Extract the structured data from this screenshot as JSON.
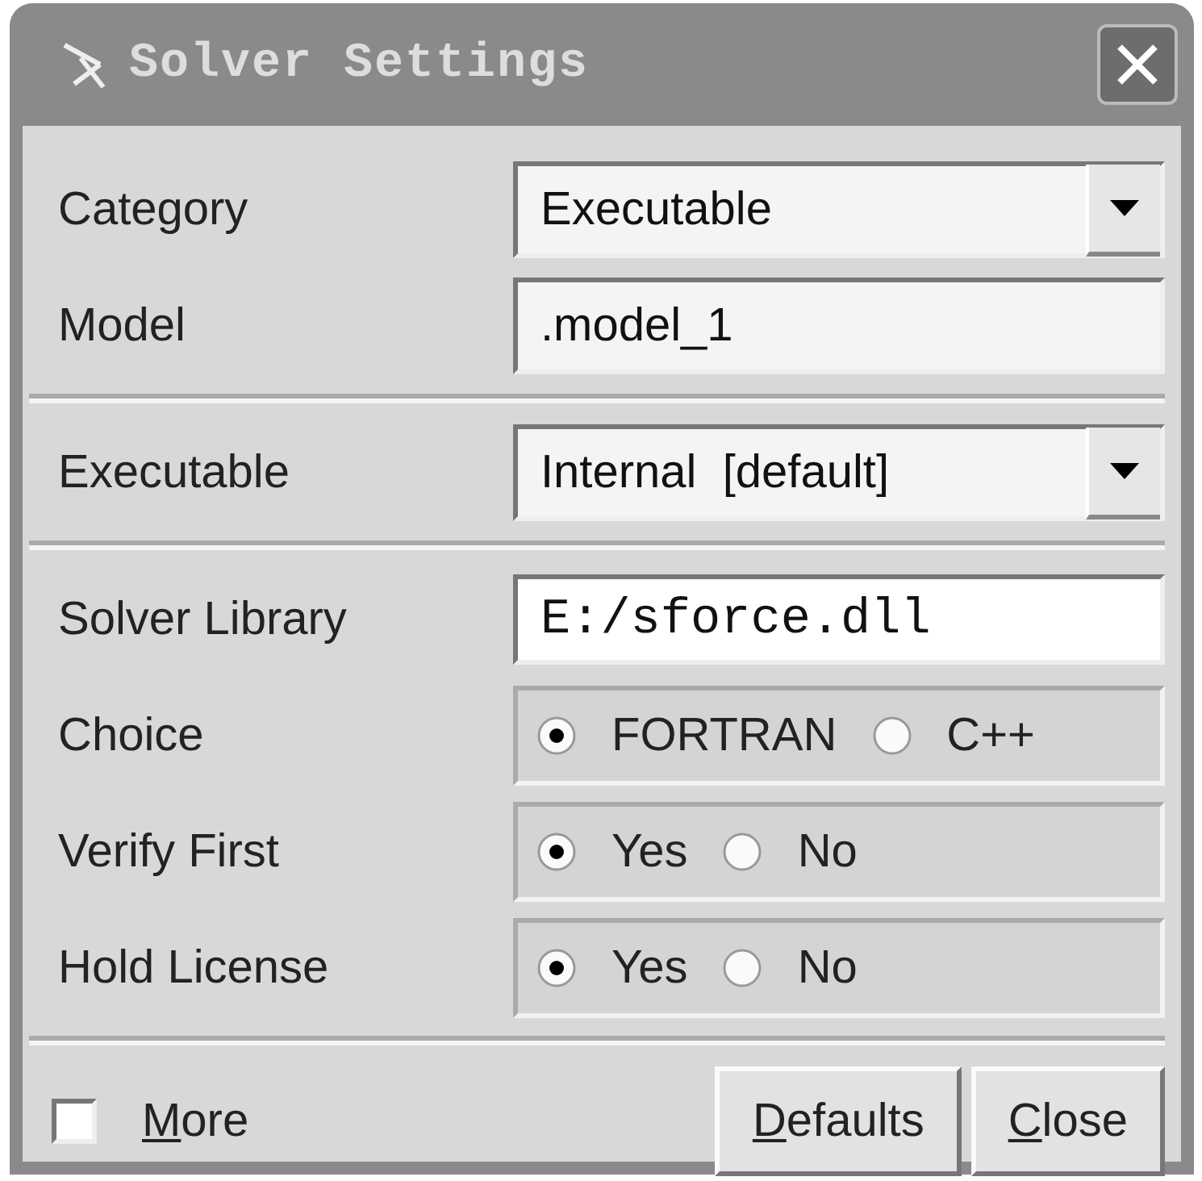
{
  "window": {
    "title": "Solver Settings"
  },
  "sections": [
    {
      "rows": [
        {
          "kind": "dropdown",
          "label": "Category",
          "value": "Executable"
        },
        {
          "kind": "text",
          "label": "Model",
          "value": ".model_1"
        }
      ]
    },
    {
      "rows": [
        {
          "kind": "dropdown",
          "label": "Executable",
          "value": "Internal  [default]"
        }
      ]
    },
    {
      "rows": [
        {
          "kind": "path",
          "label": "Solver Library",
          "value": "E:/sforce.dll"
        },
        {
          "kind": "radio",
          "label": "Choice",
          "options": [
            {
              "label": "FORTRAN",
              "selected": true
            },
            {
              "label": "C++",
              "selected": false
            }
          ]
        },
        {
          "kind": "radio",
          "label": "Verify First",
          "options": [
            {
              "label": "Yes",
              "selected": true
            },
            {
              "label": "No",
              "selected": false
            }
          ]
        },
        {
          "kind": "radio",
          "label": "Hold License",
          "options": [
            {
              "label": "Yes",
              "selected": true
            },
            {
              "label": "No",
              "selected": false
            }
          ]
        }
      ]
    }
  ],
  "footer": {
    "more": {
      "label": "More",
      "checked": false,
      "mnemonic": true
    },
    "buttons": [
      {
        "label": "Defaults",
        "mnemonic": true
      },
      {
        "label": "Close",
        "mnemonic": true
      }
    ]
  }
}
